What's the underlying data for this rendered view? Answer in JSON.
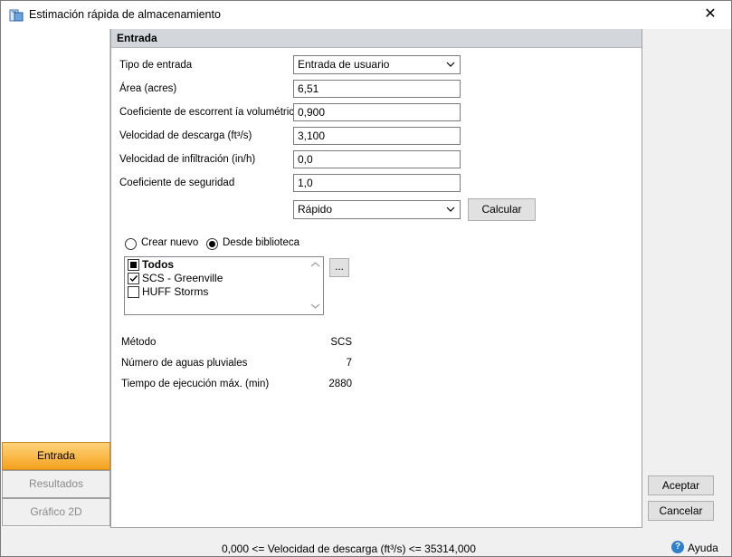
{
  "window": {
    "title": "Estimación rápida de almacenamiento"
  },
  "left_nav": {
    "items": [
      {
        "label": "Entrada"
      },
      {
        "label": "Resultados"
      },
      {
        "label": "Gráfico 2D"
      }
    ]
  },
  "entrada": {
    "header": "Entrada",
    "fields": {
      "tipo_entrada": {
        "label": "Tipo de entrada",
        "value": "Entrada de usuario"
      },
      "area": {
        "label": "Área (acres)",
        "value": "6,51"
      },
      "coef_escorrentia": {
        "label": "Coeficiente de escorrent ía volumétrica",
        "value": "0,900"
      },
      "vel_descarga": {
        "label": "Velocidad de descarga (ft³/s)",
        "value": "3,100"
      },
      "vel_infiltracion": {
        "label": "Velocidad de infiltración (in/h)",
        "value": "0,0"
      },
      "coef_seguridad": {
        "label": "Coeficiente de seguridad",
        "value": "1,0"
      }
    },
    "method_select": {
      "value": "Rápido"
    },
    "calcular_label": "Calcular",
    "radio_crear": "Crear nuevo",
    "radio_biblioteca": "Desde biblioteca",
    "library_list": [
      {
        "label": "Todos"
      },
      {
        "label": "SCS - Greenville"
      },
      {
        "label": "HUFF Storms"
      }
    ],
    "browse_label": "...",
    "info": {
      "metodo": {
        "label": "Método",
        "value": "SCS"
      },
      "num_aguas": {
        "label": "Número de aguas pluviales",
        "value": "7"
      },
      "tiempo_ejecucion": {
        "label": "Tiempo de ejecución máx. (min)",
        "value": "2880"
      }
    }
  },
  "buttons": {
    "aceptar": "Aceptar",
    "cancelar": "Cancelar"
  },
  "status": {
    "message": "0,000 <= Velocidad de descarga (ft³/s) <= 35314,000",
    "help_label": "Ayuda"
  }
}
